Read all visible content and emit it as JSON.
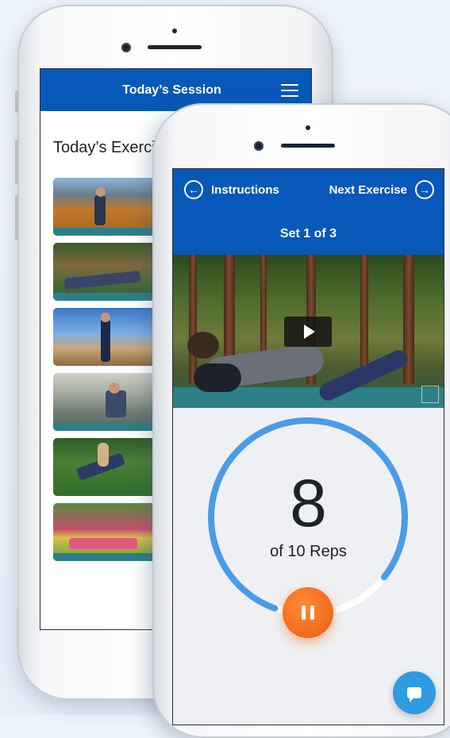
{
  "back_screen": {
    "header_title": "Today’s Session",
    "section_title": "Today’s Exercises",
    "exercises": [
      {
        "thumb": "outdoor-mountain"
      },
      {
        "thumb": "foam-roller-forest"
      },
      {
        "thumb": "standing-fence"
      },
      {
        "thumb": "seated-river"
      },
      {
        "thumb": "bent-over-garden"
      },
      {
        "thumb": "lying-flowers"
      }
    ]
  },
  "front_screen": {
    "prev_label": "Instructions",
    "next_label": "Next Exercise",
    "set_label": "Set 1 of 3",
    "video_icon": "play-icon",
    "rep_count": "8",
    "rep_label": "of 10 Reps",
    "rep_progress": 0.8,
    "pause_icon": "pause-icon"
  },
  "colors": {
    "brand_blue": "#0758b9",
    "ring_blue": "#4a9be8",
    "pause_orange": "#f26a1b",
    "chat_blue": "#2f9be0"
  },
  "chat_icon": "chat-bubble-icon"
}
